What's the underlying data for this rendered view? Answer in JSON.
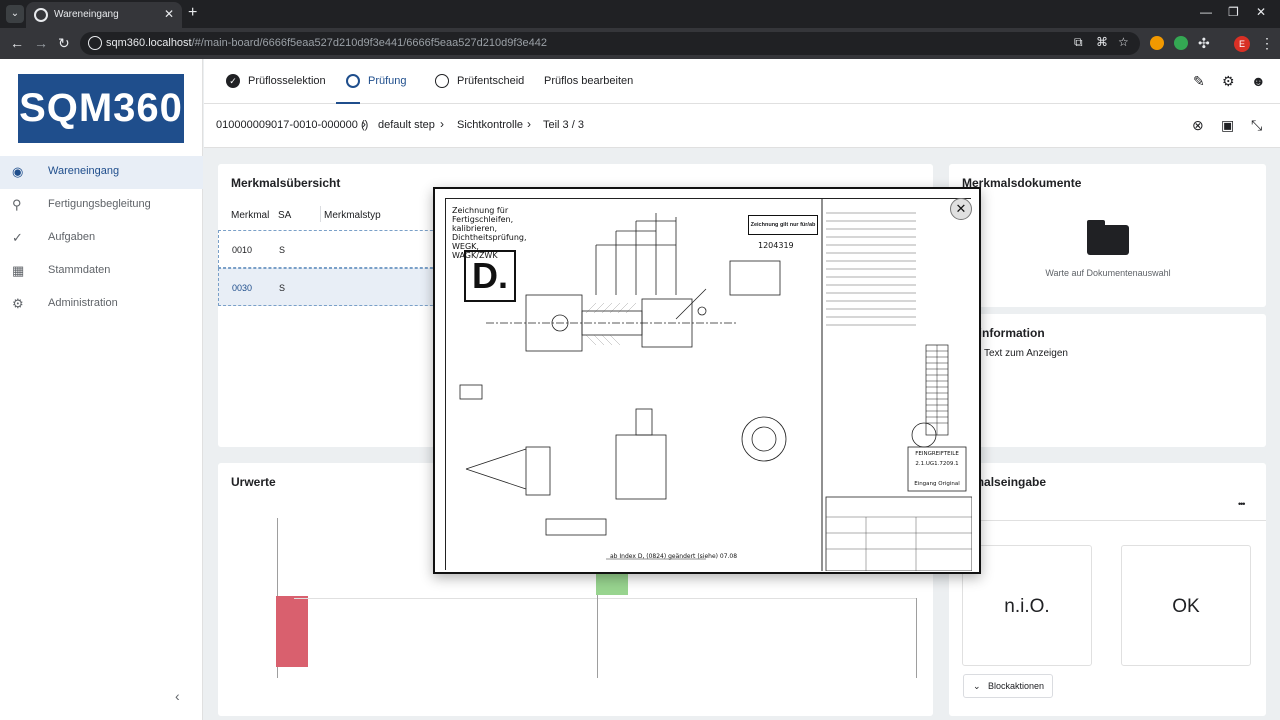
{
  "browser": {
    "tab_title": "Wareneingang",
    "url_host": "sqm360.localhost",
    "url_path": "/#/main-board/6666f5eaa527d210d9f3e441/6666f5eaa527d210d9f3e442",
    "profile_initial": "E"
  },
  "app": {
    "logo_text": "SQM360",
    "sidebar": {
      "items": [
        {
          "label": "Wareneingang",
          "icon": "eye-icon"
        },
        {
          "label": "Fertigungsbegleitung",
          "icon": "search-icon"
        },
        {
          "label": "Aufgaben",
          "icon": "check-circle-icon"
        },
        {
          "label": "Stammdaten",
          "icon": "grid-icon"
        },
        {
          "label": "Administration",
          "icon": "admin-gear-icon"
        }
      ],
      "collapse": "‹"
    },
    "steps": [
      {
        "label": "Prüflosselektion"
      },
      {
        "label": "Prüfung"
      },
      {
        "label": "Prüfentscheid"
      },
      {
        "label": "Prüflos bearbeiten"
      }
    ],
    "breadcrumb": {
      "lot": "010000009017-0010-000000 ()",
      "step": "default step",
      "check": "Sichtkontrolle",
      "part": "Teil  3 / 3"
    },
    "merkmal": {
      "title": "Merkmalsübersicht",
      "columns": [
        "Merkmal",
        "SA",
        "Merkmalstyp"
      ],
      "rows": [
        {
          "merkmal": "0010",
          "sa": "S"
        },
        {
          "merkmal": "0030",
          "sa": "S"
        }
      ]
    },
    "dokumente": {
      "title": "Merkmalsdokumente",
      "waiting": "Warte auf Dokumentenauswahl"
    },
    "zusatz": {
      "title": "atzinformation",
      "text": "Text zum Anzeigen"
    },
    "urwerte": {
      "title": "Urwerte"
    },
    "eingabe": {
      "title": "rkmalseingabe",
      "more": "•••",
      "nio": "n.i.O.",
      "ok": "OK",
      "block": "Blockaktionen"
    }
  },
  "drawing": {
    "letter": "D.",
    "note": "Zeichnung für Fertigschleifen, kalibrieren, Dichtheitsprüfung, WEGK, WAGK/ZWK",
    "stamp": "Zeichnung gilt nur für/ab",
    "stamp_ref": "1204319",
    "legend_title": "FEINGREIFTEILE",
    "legend_num": "2.1.UG1.7209.1",
    "legend_sub": "Eingang Original",
    "footer_note": "ab Index D, (0824) geändert (siehe) 07.08",
    "colors": {
      "brand": "#1f4e8c",
      "red": "#d9606e",
      "green": "#98d48f"
    }
  }
}
